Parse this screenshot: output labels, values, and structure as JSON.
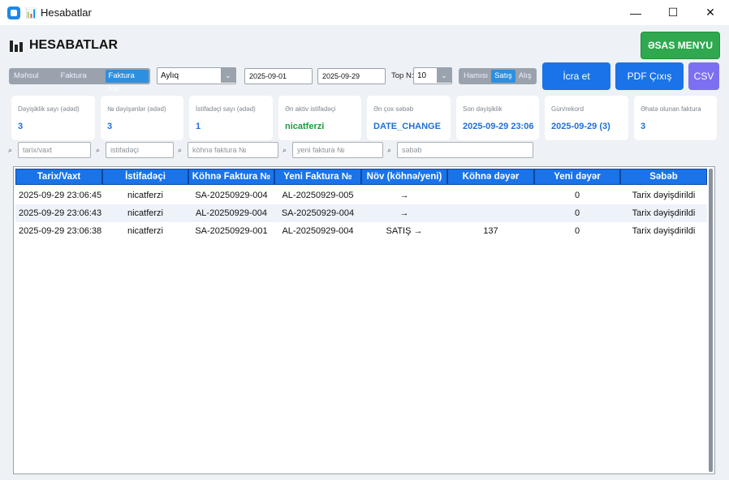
{
  "window": {
    "title": "Hesabatlar",
    "title_icon": "📊",
    "controls": {
      "minimize": "—",
      "maximize": "☐",
      "close": "✕"
    }
  },
  "page": {
    "title": "HESABATLAR",
    "main_menu": "ƏSAS MENYU"
  },
  "controls": {
    "mode_tabs": [
      "Məhsul üzrə",
      "Faktura üzrə",
      "Faktura log"
    ],
    "mode_active": "Faktura log",
    "period": "Aylıq",
    "date_from": "2025-09-01",
    "date_to": "2025-09-29",
    "topn_label": "Top N:",
    "topn_value": "10",
    "type_tabs": [
      "Hamısı",
      "Satış",
      "Alış"
    ],
    "type_active": "Satış",
    "run_btn": "İcra et",
    "pdf_btn": "PDF Çıxış",
    "csv_btn": "CSV",
    "colors": {
      "primary": "#1a73e8",
      "csv": "#7c6ff2",
      "green": "#2fa84f"
    }
  },
  "stats": [
    {
      "label": "Dəyişiklik sayı (ədəd)",
      "value": "3"
    },
    {
      "label": "№ dəyişənlər (ədəd)",
      "value": "3"
    },
    {
      "label": "İstifadəçi sayı (ədəd)",
      "value": "1"
    },
    {
      "label": "Ən aktiv istifadəçi",
      "value": "nicatferzi"
    },
    {
      "label": "Ən çox səbəb",
      "value": "DATE_CHANGE"
    },
    {
      "label": "Son dəyişiklik",
      "value": "2025-09-29 23:06"
    },
    {
      "label": "Gün/rekord",
      "value": "2025-09-29 (3)"
    },
    {
      "label": "Əhatə olunan faktura",
      "value": "3"
    }
  ],
  "filters": {
    "search_icon": "⌕",
    "placeholders": [
      "tarix/vaxt",
      "istifadəçi",
      "köhnə faktura №",
      "yeni faktura №",
      "səbəb"
    ]
  },
  "table": {
    "columns": [
      "Tarix/Vaxt",
      "İstifadəçi",
      "Köhnə Faktura №",
      "Yeni Faktura №",
      "Növ (köhnə/yeni)",
      "Köhnə dəyər",
      "Yeni dəyər",
      "Səbəb"
    ],
    "rows": [
      [
        "2025-09-29 23:06:45",
        "nicatferzi",
        "SA-20250929-004",
        "AL-20250929-005",
        "→",
        "",
        "0",
        "Tarix dəyişdirildi"
      ],
      [
        "2025-09-29 23:06:43",
        "nicatferzi",
        "AL-20250929-004",
        "SA-20250929-004",
        "→",
        "",
        "0",
        "Tarix dəyişdirildi"
      ],
      [
        "2025-09-29 23:06:38",
        "nicatferzi",
        "SA-20250929-001",
        "AL-20250929-004",
        "SATIŞ →",
        "137",
        "0",
        "Tarix dəyişdirildi"
      ]
    ]
  }
}
